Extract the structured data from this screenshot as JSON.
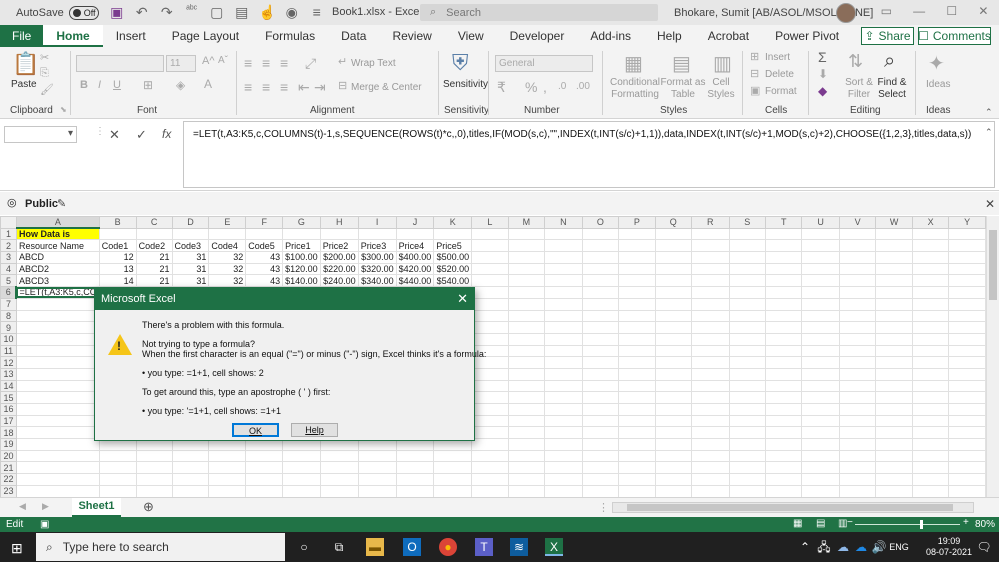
{
  "titlebar": {
    "autosave_label": "AutoSave",
    "autosave_state": "Off",
    "doc_title": "Book1.xlsx  -  Excel",
    "search_placeholder": "Search",
    "user": "Bhokare, Sumit [AB/ASOL/MSOL/PUNE]"
  },
  "ribbon_tabs": [
    "File",
    "Home",
    "Insert",
    "Page Layout",
    "Formulas",
    "Data",
    "Review",
    "View",
    "Developer",
    "Add-ins",
    "Help",
    "Acrobat",
    "Power Pivot"
  ],
  "active_tab": "Home",
  "share_label": "Share",
  "comments_label": "Comments",
  "ribbon": {
    "paste": "Paste",
    "font_size": "11",
    "wrap_text": "Wrap Text",
    "merge_center": "Merge & Center",
    "number_format": "General",
    "sensitivity": "Sensitivity",
    "conditional_formatting": "Conditional Formatting",
    "format_as_table": "Format as Table",
    "cell_styles": "Cell Styles",
    "insert": "Insert",
    "delete": "Delete",
    "format": "Format",
    "sort_filter": "Sort & Filter",
    "find_select": "Find & Select",
    "ideas": "Ideas",
    "groups": {
      "clipboard": "Clipboard",
      "font": "Font",
      "alignment": "Alignment",
      "sensitivity": "Sensitivity",
      "number": "Number",
      "styles": "Styles",
      "cells": "Cells",
      "editing": "Editing",
      "ideas": "Ideas"
    }
  },
  "formula_bar": {
    "name_box": "",
    "formula": "=LET(t,A3:K5,c,COLUMNS(t)-1,s,SEQUENCE(ROWS(t)*c,,0),titles,IF(MOD(s,c),\"\",INDEX(t,INT(s/c)+1,1)),data,INDEX(t,INT(s/c)+1,MOD(s,c)+2),CHOOSE({1,2,3},titles,data,s))"
  },
  "sheet_view": {
    "label": "Public"
  },
  "columns": [
    "A",
    "B",
    "C",
    "D",
    "E",
    "F",
    "G",
    "H",
    "I",
    "J",
    "K",
    "L",
    "M",
    "N",
    "O",
    "P",
    "Q",
    "R",
    "S",
    "T",
    "U",
    "V",
    "W",
    "X",
    "Y"
  ],
  "rows": [
    [
      "How Data is",
      "",
      "",
      "",
      "",
      "",
      "",
      "",
      "",
      "",
      ""
    ],
    [
      "Resource Name",
      "Code1",
      "Code2",
      "Code3",
      "Code4",
      "Code5",
      "Price1",
      "Price2",
      "Price3",
      "Price4",
      "Price5"
    ],
    [
      "ABCD",
      "12",
      "21",
      "31",
      "32",
      "43",
      "$100.00",
      "$200.00",
      "$300.00",
      "$400.00",
      "$500.00"
    ],
    [
      "ABCD2",
      "13",
      "21",
      "31",
      "32",
      "43",
      "$120.00",
      "$220.00",
      "$320.00",
      "$420.00",
      "$520.00"
    ],
    [
      "ABCD3",
      "14",
      "21",
      "31",
      "32",
      "43",
      "$140.00",
      "$240.00",
      "$340.00",
      "$440.00",
      "$540.00"
    ],
    [
      "=LET(t,A3:K5,c,CO",
      "",
      "",
      "",
      "",
      "",
      "",
      "",
      "",
      "",
      ""
    ]
  ],
  "row_count": 23,
  "sheet_tab": "Sheet1",
  "statusbar": {
    "mode": "Edit",
    "zoom": "80%"
  },
  "taskbar": {
    "search_placeholder": "Type here to search",
    "language": "ENG",
    "time": "19:09",
    "date": "08-07-2021"
  },
  "dialog": {
    "title": "Microsoft Excel",
    "line1": "There's a problem with this formula.",
    "line2": "Not trying to type a formula?",
    "line3": "When the first character is an equal (\"=\") or minus (\"-\") sign, Excel thinks it's a formula:",
    "line4": "• you type:   =1+1, cell shows:   2",
    "line5": "To get around this, type an apostrophe ( ' ) first:",
    "line6": "• you type:   '=1+1, cell shows:   =1+1",
    "ok": "OK",
    "help": "Help"
  },
  "colors": {
    "excel_green": "#1e7145",
    "highlight": "#ffff00",
    "status_green": "#217346"
  }
}
